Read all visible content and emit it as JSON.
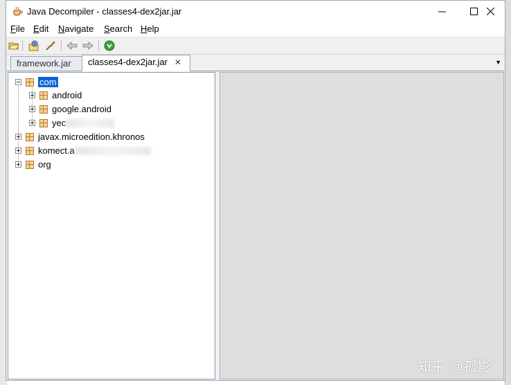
{
  "window": {
    "title": "Java Decompiler - classes4-dex2jar.jar",
    "controls": {
      "minimize": "—",
      "maximize": "☐",
      "close": "✕"
    }
  },
  "menu": {
    "items": [
      {
        "label": "File",
        "mnemonic": "F",
        "rest": "ile"
      },
      {
        "label": "Edit",
        "mnemonic": "E",
        "rest": "dit"
      },
      {
        "label": "Navigate",
        "mnemonic": "N",
        "rest": "avigate"
      },
      {
        "label": "Search",
        "mnemonic": "S",
        "rest": "earch"
      },
      {
        "label": "Help",
        "mnemonic": "H",
        "rest": "elp"
      }
    ]
  },
  "toolbar": {
    "icons": [
      "open-file-icon",
      "open-type-icon",
      "search-icon",
      "back-arrow-icon",
      "forward-arrow-icon",
      "go-green-icon"
    ]
  },
  "tabs": [
    {
      "label": "framework.jar",
      "active": false
    },
    {
      "label": "classes4-dex2jar.jar",
      "active": true,
      "close": "✕"
    }
  ],
  "tabbar": {
    "dropdown": "▼"
  },
  "tree": {
    "nodes": [
      {
        "label": "com",
        "level": 0,
        "expanded": true,
        "selected": true
      },
      {
        "label": "android",
        "level": 1,
        "expanded": false
      },
      {
        "label": "google.android",
        "level": 1,
        "expanded": false
      },
      {
        "label": "yec",
        "level": 1,
        "expanded": false,
        "obscured": true
      },
      {
        "label": "javax.microedition.khronos",
        "level": 0,
        "expanded": false
      },
      {
        "label": "komect.a",
        "level": 0,
        "expanded": false,
        "obscured": true
      },
      {
        "label": "org",
        "level": 0,
        "expanded": false
      }
    ]
  },
  "watermark": "知乎 @孤影",
  "colors": {
    "selection": "#0a64d8",
    "package_icon": "#f7d39a",
    "content_bg": "#dedede"
  }
}
